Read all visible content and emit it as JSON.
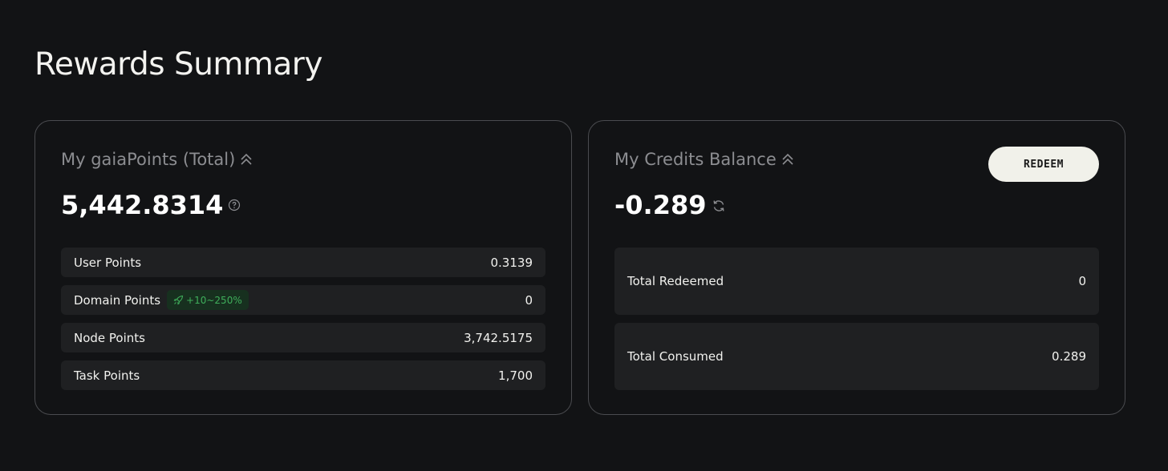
{
  "page": {
    "title": "Rewards Summary"
  },
  "points_card": {
    "heading": "My gaiaPoints (Total)",
    "total": "5,442.8314",
    "rows": [
      {
        "label": "User Points",
        "value": "0.3139"
      },
      {
        "label": "Domain Points",
        "value": "0",
        "badge": "+10~250%"
      },
      {
        "label": "Node Points",
        "value": "3,742.5175"
      },
      {
        "label": "Task Points",
        "value": "1,700"
      }
    ]
  },
  "credits_card": {
    "heading": "My Credits Balance",
    "balance": "-0.289",
    "redeem_label": "REDEEM",
    "rows": [
      {
        "label": "Total Redeemed",
        "value": "0"
      },
      {
        "label": "Total Consumed",
        "value": "0.289"
      }
    ]
  },
  "colors": {
    "background": "#121315",
    "card_border": "#4a4b4f",
    "row_background": "#1f2022",
    "muted_text": "#8c8d91",
    "badge_green": "#3fae5b",
    "badge_bg": "#17301f",
    "button_bg": "#f1f1ea"
  },
  "icons": {
    "heading_toggle": "chevron-double-up-icon",
    "total_help": "help-icon",
    "balance_refresh": "refresh-icon",
    "badge": "rocket-icon"
  }
}
